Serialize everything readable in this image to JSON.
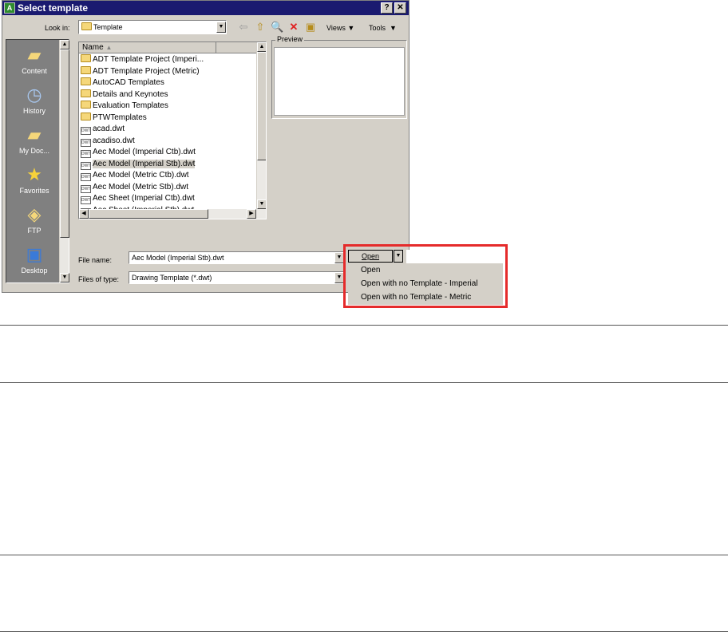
{
  "dialog": {
    "title": "Select template",
    "help_label": "?",
    "close_label": "✕"
  },
  "toolbar": {
    "look_in_label": "Look in:",
    "look_in_value": "Template",
    "views_label": "Views",
    "tools_label": "Tools"
  },
  "places": [
    {
      "label": "Content",
      "icon": "folder-icon"
    },
    {
      "label": "History",
      "icon": "history-icon"
    },
    {
      "label": "My Doc...",
      "icon": "my-documents-icon"
    },
    {
      "label": "Favorites",
      "icon": "favorites-star-icon"
    },
    {
      "label": "FTP",
      "icon": "ftp-icon"
    },
    {
      "label": "Desktop",
      "icon": "desktop-icon"
    }
  ],
  "file_list": {
    "header_name": "Name",
    "items": [
      {
        "name": "ADT Template Project (Imperi...",
        "type": "folder"
      },
      {
        "name": "ADT Template Project (Metric)",
        "type": "folder"
      },
      {
        "name": "AutoCAD Templates",
        "type": "folder"
      },
      {
        "name": "Details and Keynotes",
        "type": "folder"
      },
      {
        "name": "Evaluation Templates",
        "type": "folder"
      },
      {
        "name": "PTWTemplates",
        "type": "folder"
      },
      {
        "name": "acad.dwt",
        "type": "dwt"
      },
      {
        "name": "acadiso.dwt",
        "type": "dwt"
      },
      {
        "name": "Aec Model (Imperial Ctb).dwt",
        "type": "dwt"
      },
      {
        "name": "Aec Model (Imperial Stb).dwt",
        "type": "dwt",
        "selected": true
      },
      {
        "name": "Aec Model (Metric Ctb).dwt",
        "type": "dwt"
      },
      {
        "name": "Aec Model (Metric Stb).dwt",
        "type": "dwt"
      },
      {
        "name": "Aec Sheet (Imperial Ctb).dwt",
        "type": "dwt"
      },
      {
        "name": "Aec Sheet (Imperial Stb).dwt",
        "type": "dwt"
      }
    ]
  },
  "preview": {
    "label": "Preview"
  },
  "file_name": {
    "label": "File name:",
    "value": "Aec Model (Imperial Stb).dwt"
  },
  "file_type": {
    "label": "Files of type:",
    "value": "Drawing Template (*.dwt)"
  },
  "open_button": {
    "label": "Open"
  },
  "open_menu": {
    "items": [
      "Open",
      "Open with no Template - Imperial",
      "Open with no Template - Metric"
    ]
  },
  "colors": {
    "highlight": "#e52b2b",
    "title_bar": "#1a1a70",
    "dialog_bg": "#d4d0c8"
  }
}
